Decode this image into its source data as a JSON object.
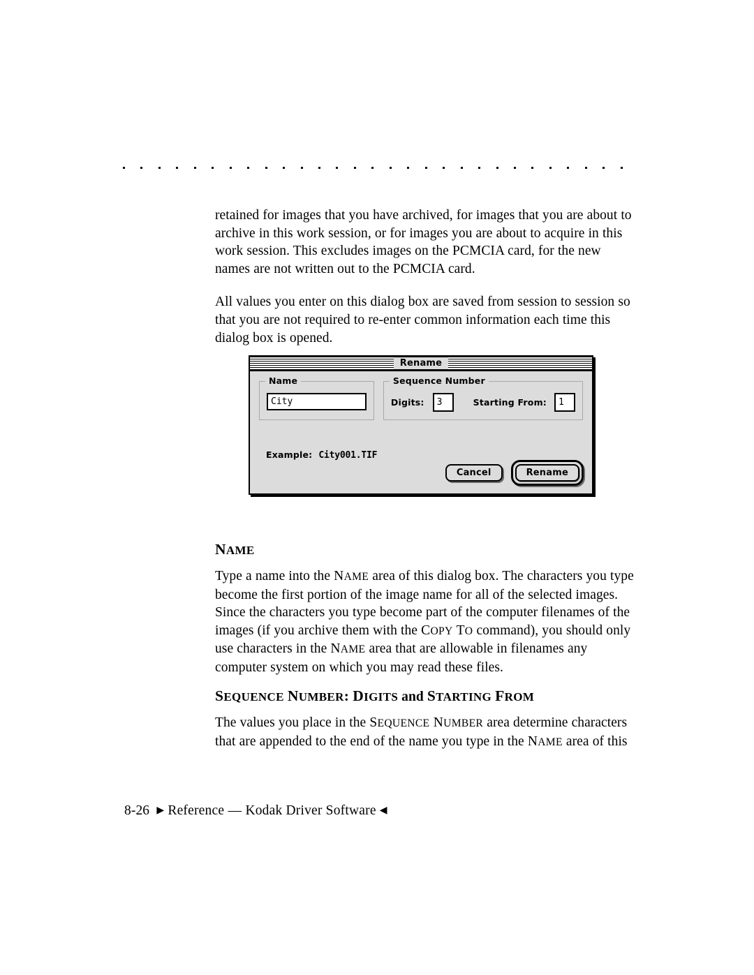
{
  "page": {
    "decoration": {
      "dot_count": 29
    }
  },
  "body": {
    "paragraph_1": "retained for images that you have archived, for images that you are about to archive in this work session, or for images you are about to acquire in this work session. This excludes images on the PCMCIA card, for the new names are not written out to the PCMCIA card.",
    "paragraph_2": "All values you enter on this dialog box are saved from session to session so that you are not required to re-enter common information each time this dialog box is opened."
  },
  "dialog": {
    "title": "Rename",
    "name_group": {
      "label": "Name",
      "value": "City"
    },
    "sequence_group": {
      "label": "Sequence Number",
      "digits_label": "Digits:",
      "digits_value": "3",
      "starting_from_label": "Starting From:",
      "starting_from_value": "1"
    },
    "example": {
      "label": "Example:",
      "value": "City001.TIF"
    },
    "buttons": {
      "cancel": "Cancel",
      "rename": "Rename"
    }
  },
  "sections": [
    {
      "heading": {
        "cap": "N",
        "small": "AME"
      },
      "text_parts": [
        "Type a name into the ",
        "N",
        "AME",
        " area of this dialog box. The characters you type become the first portion of the image name for all of the selected images. Since the characters you type become part of the computer filenames of the images (if you archive them with the ",
        "C",
        "OPY",
        " T",
        "O",
        " command), you should only use characters in the ",
        "N",
        "AME",
        " area that are allowable in filenames any computer system on which you may read these files."
      ]
    },
    {
      "heading_parts": {
        "a_cap": "S",
        "a_small": "EQUENCE",
        "b_cap": "N",
        "b_small": "UMBER",
        "colon": ":",
        "c_cap": "D",
        "c_small": "IGITS",
        "and": "and",
        "d_cap": "S",
        "d_small": "TARTING",
        "e_cap": "F",
        "e_small": "ROM"
      },
      "text_parts": [
        "The values you place in the ",
        "S",
        "EQUENCE",
        " N",
        "UMBER",
        " area determine characters that are appended to the end of the name you type in the ",
        "N",
        "AME",
        " area of this"
      ]
    }
  ],
  "footer": {
    "page_number": "8-26",
    "arrow_left": "▶",
    "text": "Reference",
    "dash": "—",
    "product": "Kodak Driver Software",
    "arrow_right": "◀"
  }
}
